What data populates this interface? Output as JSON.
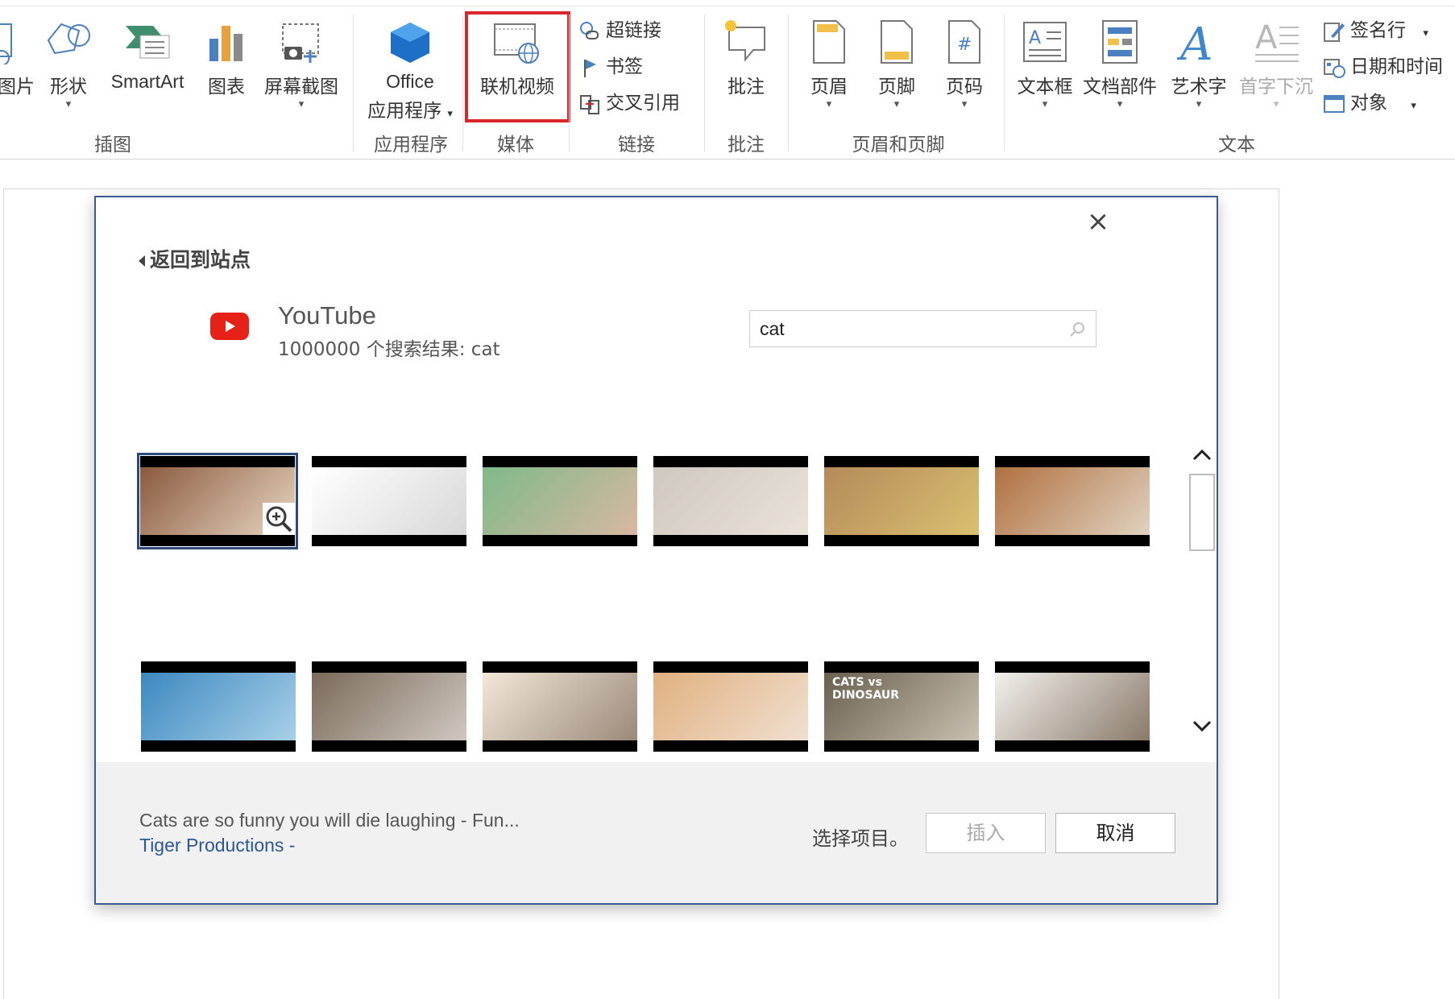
{
  "ribbon": {
    "tools": [
      {
        "label": "图片"
      },
      {
        "label": "形状"
      },
      {
        "label": "SmartArt"
      },
      {
        "label": "图表"
      },
      {
        "label": "屏幕截图"
      },
      {
        "label_line1": "Office",
        "label_line2": "应用程序"
      },
      {
        "label": "联机视频"
      },
      {
        "label": "批注"
      },
      {
        "label": "页眉"
      },
      {
        "label": "页脚"
      },
      {
        "label": "页码"
      },
      {
        "label": "文本框"
      },
      {
        "label": "文档部件"
      },
      {
        "label": "艺术字"
      },
      {
        "label": "首字下沉"
      }
    ],
    "links": {
      "hyperlink": "超链接",
      "bookmark": "书签",
      "cross_ref": "交叉引用"
    },
    "text_small": {
      "signature": "签名行",
      "datetime": "日期和时间",
      "object": "对象"
    },
    "groups": {
      "illustrations": "插图",
      "apps": "应用程序",
      "media": "媒体",
      "links": "链接",
      "comments": "批注",
      "header_footer": "页眉和页脚",
      "text": "文本"
    },
    "highlight_color": "#d9262b"
  },
  "dialog": {
    "back_label": "返回到站点",
    "close_symbol": "×",
    "provider": "YouTube",
    "result_count": "1000000 个搜索结果: cat",
    "search_value": "cat",
    "thumbnails": [
      {
        "colors": [
          "#8a5a40",
          "#e8d6c0"
        ]
      },
      {
        "colors": [
          "#ffffff",
          "#d8d8d8"
        ]
      },
      {
        "colors": [
          "#7fb98a",
          "#d8b8a0"
        ]
      },
      {
        "colors": [
          "#cfc8c0",
          "#e9e2d8"
        ]
      },
      {
        "colors": [
          "#b58a5a",
          "#d9c070"
        ]
      },
      {
        "colors": [
          "#b07040",
          "#e0d2c0"
        ]
      },
      {
        "colors": [
          "#3c88c0",
          "#a8d0e8"
        ]
      },
      {
        "colors": [
          "#7a6a5a",
          "#d0c8c0"
        ]
      },
      {
        "colors": [
          "#f3e7d8",
          "#9a8a7a"
        ]
      },
      {
        "colors": [
          "#e0b080",
          "#f0e0d0"
        ]
      },
      {
        "colors": [
          "#6a6050",
          "#c8c0b0"
        ]
      },
      {
        "colors": [
          "#f2f0ec",
          "#8a7a6a"
        ]
      }
    ],
    "thumb_texts": {
      "cats_vs": "CATS vs",
      "dinosaur": "DINOSAUR"
    },
    "selected_title": "Cats are so funny you will die laughing - Fun...",
    "selected_author": "Tiger Productions -",
    "select_hint": "选择项目。",
    "insert_button": "插入",
    "cancel_button": "取消",
    "accent_color": "#2b5797",
    "youtube_red": "#e62117"
  }
}
